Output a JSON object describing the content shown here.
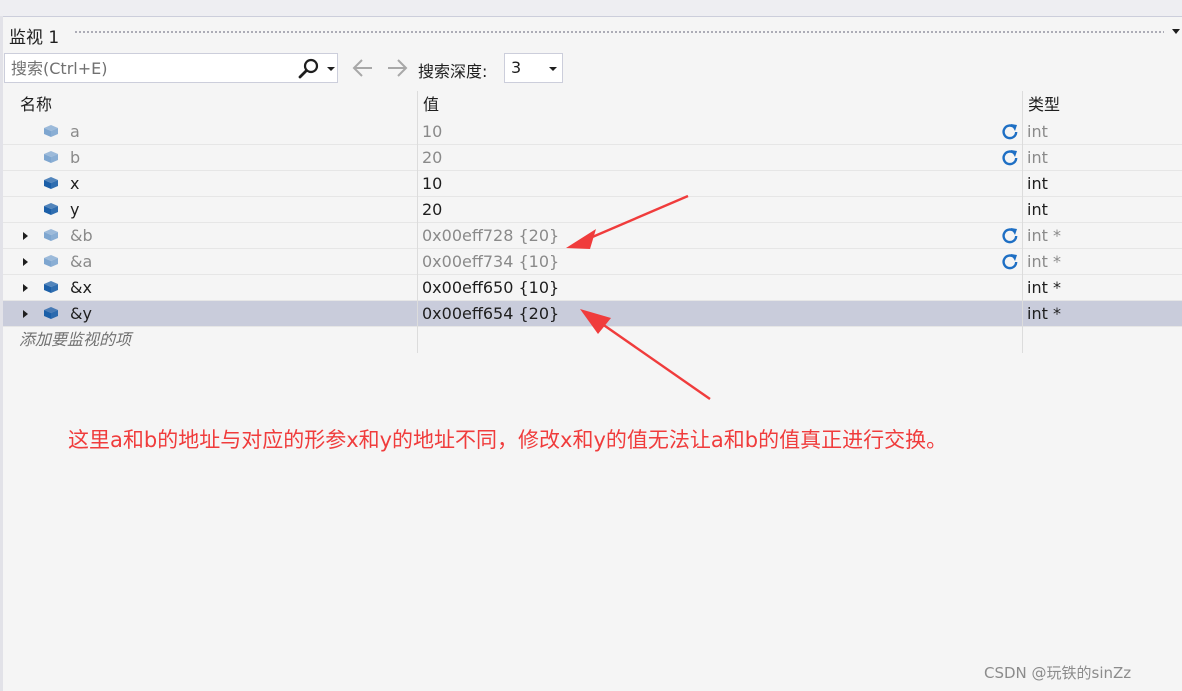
{
  "panel": {
    "title": "监视 1"
  },
  "toolbar": {
    "search_placeholder": "搜索(Ctrl+E)",
    "depth_label": "搜索深度:",
    "depth_value": "3"
  },
  "columns": {
    "name": "名称",
    "value": "值",
    "type": "类型"
  },
  "rows": [
    {
      "name": "a",
      "value": "10",
      "type": "int",
      "stale": true,
      "expandable": false
    },
    {
      "name": "b",
      "value": "20",
      "type": "int",
      "stale": true,
      "expandable": false
    },
    {
      "name": "x",
      "value": "10",
      "type": "int",
      "stale": false,
      "expandable": false
    },
    {
      "name": "y",
      "value": "20",
      "type": "int",
      "stale": false,
      "expandable": false
    },
    {
      "name": "&b",
      "value": "0x00eff728 {20}",
      "type": "int *",
      "stale": true,
      "expandable": true
    },
    {
      "name": "&a",
      "value": "0x00eff734 {10}",
      "type": "int *",
      "stale": true,
      "expandable": true
    },
    {
      "name": "&x",
      "value": "0x00eff650 {10}",
      "type": "int *",
      "stale": false,
      "expandable": true
    },
    {
      "name": "&y",
      "value": "0x00eff654 {20}",
      "type": "int *",
      "stale": false,
      "expandable": true,
      "selected": true
    }
  ],
  "add_watch_label": "添加要监视的项",
  "annotation": "这里a和b的地址与对应的形参x和y的地址不同，修改x和y的值无法让a和b的值真正进行交换。",
  "watermark": "CSDN @玩铁的sinZz",
  "colors": {
    "annotation": "#f03c3c",
    "selected_row": "#c9ccdb",
    "var_icon_active": "#1b5fa8",
    "var_icon_stale": "#7ea6d0",
    "refresh_icon": "#1e6fc4"
  },
  "icons": {
    "search": "search-icon",
    "back": "arrow-left-icon",
    "forward": "arrow-right-icon",
    "variable": "variable-icon",
    "refresh": "refresh-icon",
    "expand": "expand-triangle-icon"
  }
}
